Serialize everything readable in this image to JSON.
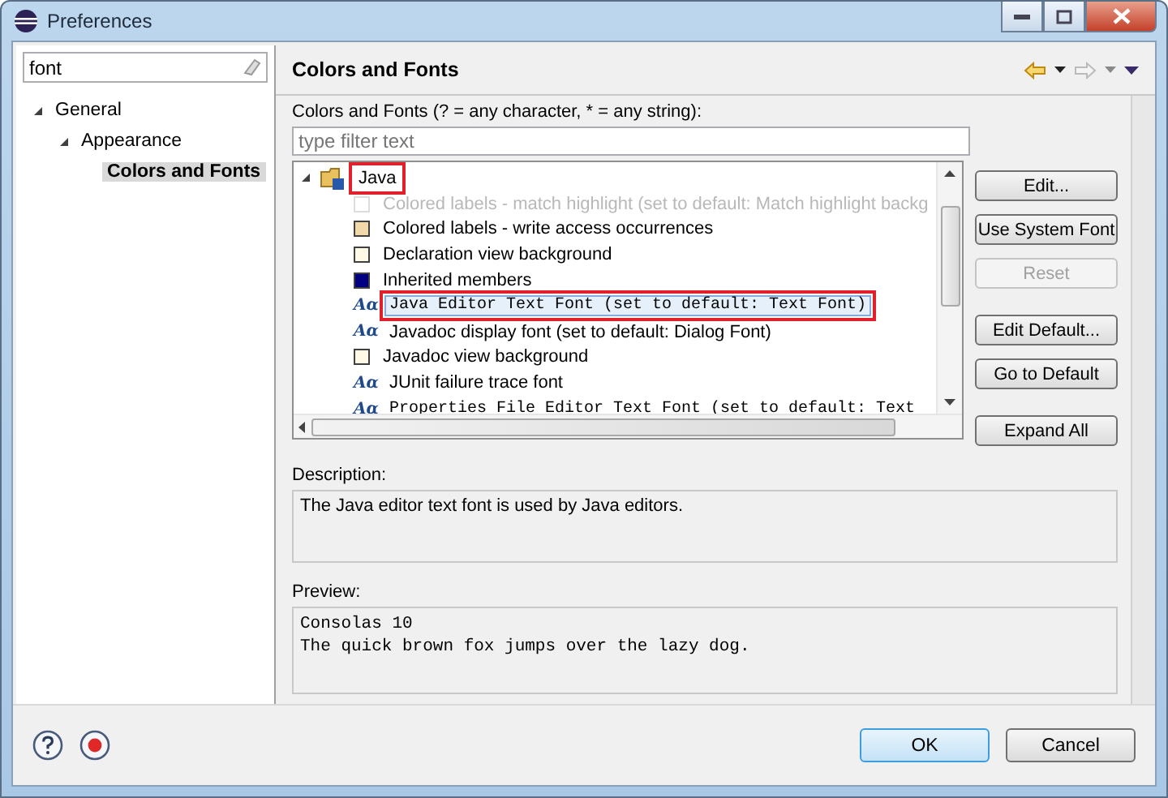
{
  "window": {
    "title": "Preferences"
  },
  "filter": {
    "value": "font"
  },
  "sidebar": {
    "items": [
      {
        "label": "General",
        "expanded": true,
        "selected": false,
        "children": [
          {
            "label": "Appearance",
            "expanded": true,
            "selected": false,
            "children": [
              {
                "label": "Colors and Fonts",
                "selected": true
              }
            ]
          }
        ]
      }
    ]
  },
  "page": {
    "title": "Colors and Fonts",
    "filter_label": "Colors and Fonts (? = any character, * = any string):",
    "filter_placeholder": "type filter text"
  },
  "tree": {
    "root": {
      "label": "Java",
      "expanded": true,
      "highlighted": true
    },
    "items": [
      {
        "kind": "color",
        "label": "Colored labels - match highlight (set to default: Match highlight backg",
        "disabled": true,
        "selected": false,
        "monospace": false,
        "highlighted": false
      },
      {
        "kind": "color",
        "label": "Colored labels - write access occurrences",
        "color": "#f0d8a8",
        "disabled": false,
        "selected": false,
        "monospace": false,
        "highlighted": false
      },
      {
        "kind": "color",
        "label": "Declaration view background",
        "color": "#fffae6",
        "disabled": false,
        "selected": false,
        "monospace": false,
        "highlighted": false
      },
      {
        "kind": "color",
        "label": "Inherited members",
        "color": "#000080",
        "disabled": false,
        "selected": false,
        "monospace": false,
        "highlighted": false
      },
      {
        "kind": "font",
        "icon": "Aα",
        "label": "Java Editor Text Font (set to default: Text Font)",
        "disabled": false,
        "selected": true,
        "monospace": true,
        "highlighted": true
      },
      {
        "kind": "font",
        "icon": "Aα",
        "label": "Javadoc display font (set to default: Dialog Font)",
        "disabled": false,
        "selected": false,
        "monospace": false,
        "highlighted": false
      },
      {
        "kind": "color",
        "label": "Javadoc view background",
        "color": "#fffae6",
        "disabled": false,
        "selected": false,
        "monospace": false,
        "highlighted": false
      },
      {
        "kind": "font",
        "icon": "Aα",
        "label": "JUnit failure trace font",
        "disabled": false,
        "selected": false,
        "monospace": false,
        "highlighted": false
      },
      {
        "kind": "font",
        "icon": "Aα",
        "label": "Properties File Editor Text Font (set to default: Text",
        "disabled": false,
        "selected": false,
        "monospace": true,
        "highlighted": false
      }
    ]
  },
  "side_buttons": [
    {
      "label": "Edit...",
      "disabled": false
    },
    {
      "label": "Use System Font",
      "disabled": false
    },
    {
      "label": "Reset",
      "disabled": true
    },
    {
      "label": "Edit Default...",
      "disabled": false
    },
    {
      "label": "Go to Default",
      "disabled": false
    },
    {
      "label": "Expand All",
      "disabled": false
    }
  ],
  "description": {
    "label": "Description:",
    "text": "The Java editor text font is used by Java editors."
  },
  "preview": {
    "label": "Preview:",
    "lines": [
      "Consolas 10",
      "The quick brown fox jumps over the lazy dog."
    ]
  },
  "buttons": [
    {
      "label": "OK",
      "default": true
    },
    {
      "label": "Cancel",
      "default": false
    }
  ]
}
